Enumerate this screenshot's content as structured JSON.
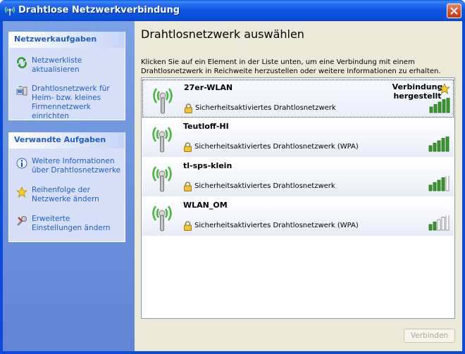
{
  "window": {
    "title": "Drahtlose Netzwerkverbindung"
  },
  "sidebar": {
    "network_tasks": {
      "header": "Netzwerkaufgaben",
      "items": [
        {
          "label": "Netzwerkliste aktualisieren",
          "icon": "refresh-icon"
        },
        {
          "label": "Drahtlosnetzwerk für Heim- bzw. kleines Firmennetzwerk einrichten",
          "icon": "wireless-setup-icon"
        }
      ]
    },
    "related_tasks": {
      "header": "Verwandte Aufgaben",
      "items": [
        {
          "label": "Weitere Informationen über Drahtlosnetzwerke",
          "icon": "info-icon"
        },
        {
          "label": "Reihenfolge der Netzwerke ändern",
          "icon": "star-icon"
        },
        {
          "label": "Erweiterte Einstellungen ändern",
          "icon": "settings-icon"
        }
      ]
    }
  },
  "main": {
    "heading": "Drahtlosnetzwerk auswählen",
    "description": "Klicken Sie auf ein Element in der Liste unten, um eine Verbindung mit einem Drahtlosnetzwerk in Reichweite herzustellen oder weitere Informationen zu erhalten.",
    "networks": [
      {
        "name": "27er-WLAN",
        "security": "Sicherheitsaktiviertes Drahtlosnetzwerk",
        "status": "Verbindung hergestellt",
        "signal_bars": 5,
        "selected": true
      },
      {
        "name": "Teutloff-HI",
        "security": "Sicherheitsaktiviertes Drahtlosnetzwerk (WPA)",
        "status": "",
        "signal_bars": 5,
        "selected": false
      },
      {
        "name": "tl-sps-klein",
        "security": "Sicherheitsaktiviertes Drahtlosnetzwerk",
        "status": "",
        "signal_bars": 4,
        "selected": false
      },
      {
        "name": "WLAN_OM",
        "security": "Sicherheitsaktiviertes Drahtlosnetzwerk (WPA)",
        "status": "",
        "signal_bars": 2,
        "selected": false
      }
    ],
    "connect_label": "Verbinden"
  },
  "colors": {
    "titlebar": "#0a4fd8",
    "sidebar_link": "#215dc6",
    "signal_on": "#3a9a2a",
    "signal_off": "#ffffff"
  }
}
